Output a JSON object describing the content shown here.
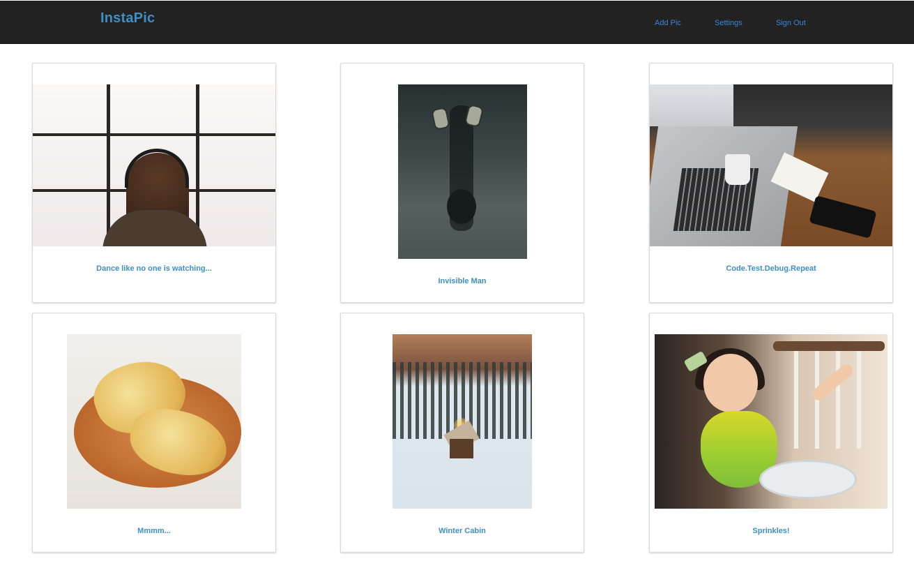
{
  "navbar": {
    "brand": "InstaPic",
    "links": [
      {
        "label": "Add Pic"
      },
      {
        "label": "Settings"
      },
      {
        "label": "Sign Out"
      }
    ]
  },
  "posts": [
    {
      "caption": "Dance like no one is watching..."
    },
    {
      "caption": "Invisible Man"
    },
    {
      "caption": "Code.Test.Debug.Repeat"
    },
    {
      "caption": "Mmmm..."
    },
    {
      "caption": "Winter Cabin"
    },
    {
      "caption": "Sprinkles!"
    }
  ]
}
